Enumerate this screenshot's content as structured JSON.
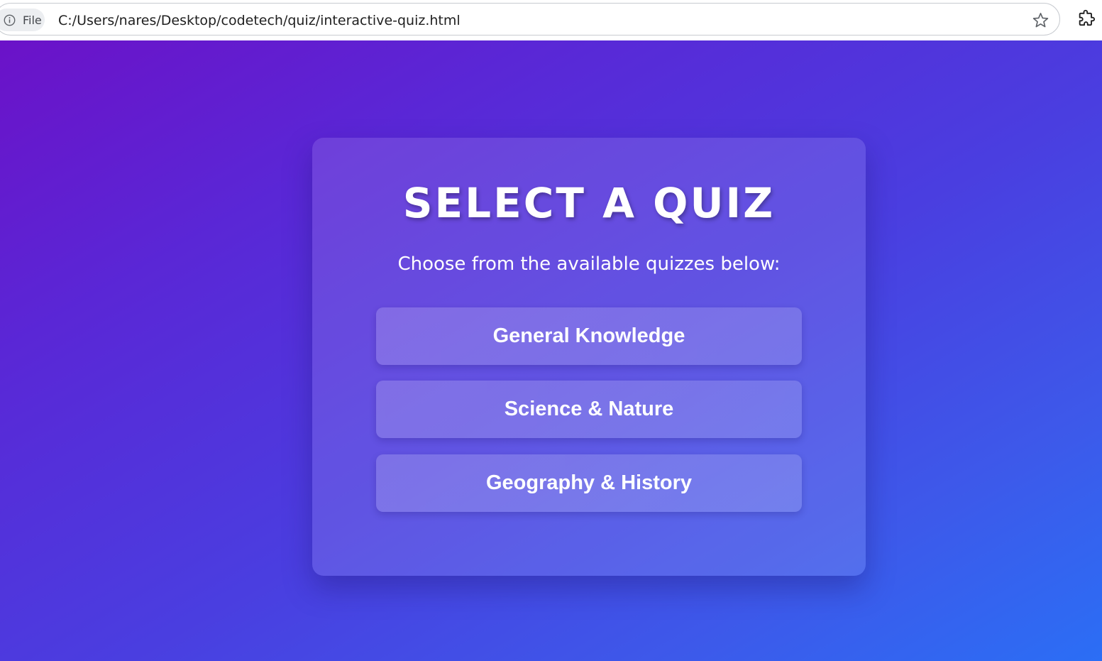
{
  "browser": {
    "chip_label": "File",
    "url": "C:/Users/nares/Desktop/codetech/quiz/interactive-quiz.html",
    "icons": [
      "info-icon",
      "star-icon",
      "extensions-icon"
    ]
  },
  "page": {
    "title": "SELECT A QUIZ",
    "subtitle": "Choose from the available quizzes below:",
    "quizzes": [
      {
        "label": "General Knowledge"
      },
      {
        "label": "Science & Nature"
      },
      {
        "label": "Geography & History"
      }
    ]
  },
  "colors": {
    "gradient_start": "#6b12c8",
    "gradient_end": "#2b6ef5",
    "text": "#ffffff"
  }
}
